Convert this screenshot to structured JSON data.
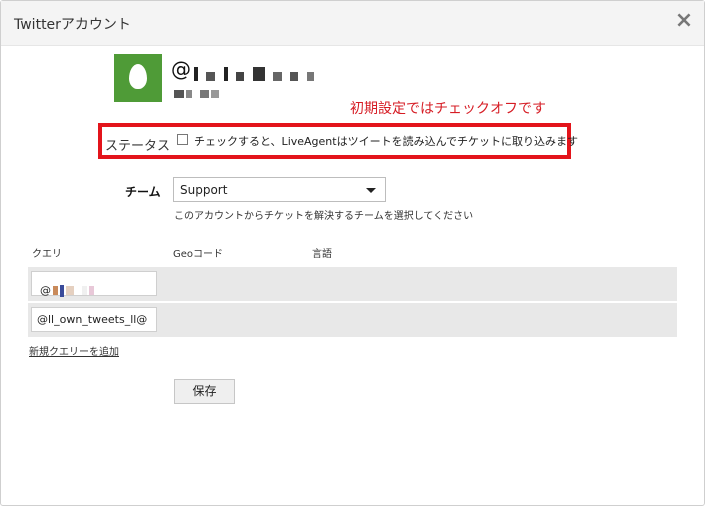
{
  "dialog": {
    "title": "Twitterアカウント",
    "close_label": "×"
  },
  "account": {
    "handle_prefix": "@"
  },
  "annotation": {
    "text": "初期設定ではチェックオフです"
  },
  "status": {
    "label": "ステータス",
    "checkbox_text": "チェックすると、LiveAgentはツイートを読み込んでチケットに取り込みます",
    "checked": false
  },
  "team": {
    "label": "チーム",
    "selected": "Support",
    "hint": "このアカウントからチケットを解決するチームを選択してください"
  },
  "queries": {
    "columns": [
      "クエリ",
      "Geoコード",
      "言語"
    ],
    "rows": [
      {
        "query": "@",
        "geocode": "",
        "language": ""
      },
      {
        "query": "@ll_own_tweets_ll@",
        "geocode": "",
        "language": ""
      }
    ],
    "add_link": "新規クエリーを追加"
  },
  "save_label": "保存",
  "colors": {
    "accent_red": "#e3141b",
    "avatar_green": "#4f9b37"
  }
}
